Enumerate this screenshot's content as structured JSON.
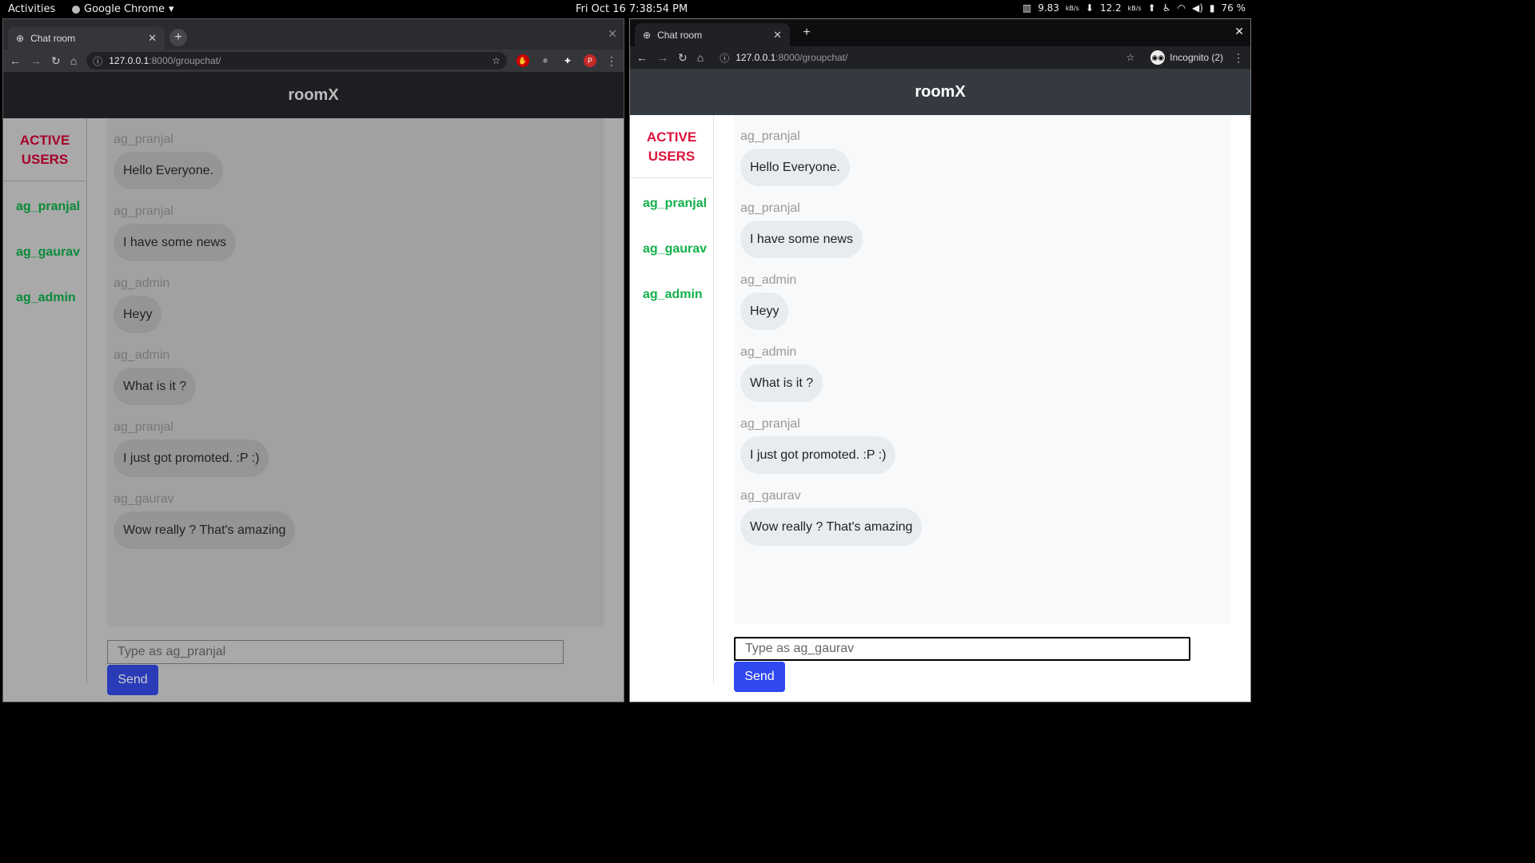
{
  "topbar": {
    "activities": "Activities",
    "app": "Google Chrome",
    "app_caret": "▾",
    "clock": "Fri Oct 16  7:38:54 PM",
    "net_down": "9.83",
    "net_down_unit": "kB/s",
    "net_up": "12.2",
    "net_up_unit": "kB/s",
    "battery": "76 %"
  },
  "left_window": {
    "tab_title": "Chat room",
    "url_host": "127.0.0.1",
    "url_path": ":8000/groupchat/",
    "profile_initial": "P"
  },
  "right_window": {
    "tab_title": "Chat room",
    "url_host": "127.0.0.1",
    "url_path": ":8000/groupchat/",
    "incognito_label": "Incognito (2)"
  },
  "room": {
    "name": "roomX",
    "active_users_title_1": "ACTIVE",
    "active_users_title_2": "USERS",
    "users": [
      "ag_pranjal",
      "ag_gaurav",
      "ag_admin"
    ]
  },
  "messages": [
    {
      "user": "ag_pranjal",
      "text": "Hello Everyone."
    },
    {
      "user": "ag_pranjal",
      "text": "I have some news"
    },
    {
      "user": "ag_admin",
      "text": "Heyy"
    },
    {
      "user": "ag_admin",
      "text": "What is it ?"
    },
    {
      "user": "ag_pranjal",
      "text": "I just got promoted. :P :)"
    },
    {
      "user": "ag_gaurav",
      "text": "Wow really ? That's amazing"
    }
  ],
  "left_input": {
    "placeholder": "Type as ag_pranjal"
  },
  "right_input": {
    "placeholder": "Type as ag_gaurav"
  },
  "send_label": "Send",
  "colors": {
    "active_users_title": "#dc143c",
    "user_name": "#12b04a",
    "send_button": "#2f48f0",
    "header_bg": "#343a40"
  }
}
